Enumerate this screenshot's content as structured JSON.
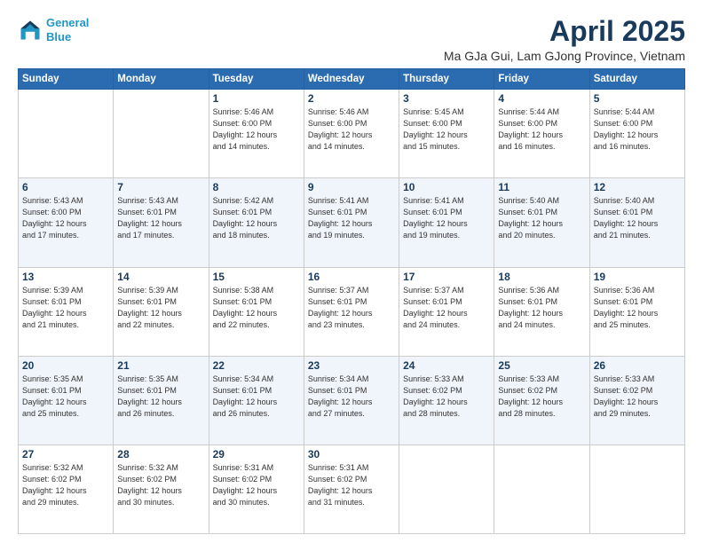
{
  "header": {
    "logo_line1": "General",
    "logo_line2": "Blue",
    "title": "April 2025",
    "subtitle": "Ma GJa Gui, Lam GJong Province, Vietnam"
  },
  "days_of_week": [
    "Sunday",
    "Monday",
    "Tuesday",
    "Wednesday",
    "Thursday",
    "Friday",
    "Saturday"
  ],
  "weeks": [
    [
      {
        "day": "",
        "info": ""
      },
      {
        "day": "",
        "info": ""
      },
      {
        "day": "1",
        "info": "Sunrise: 5:46 AM\nSunset: 6:00 PM\nDaylight: 12 hours\nand 14 minutes."
      },
      {
        "day": "2",
        "info": "Sunrise: 5:46 AM\nSunset: 6:00 PM\nDaylight: 12 hours\nand 14 minutes."
      },
      {
        "day": "3",
        "info": "Sunrise: 5:45 AM\nSunset: 6:00 PM\nDaylight: 12 hours\nand 15 minutes."
      },
      {
        "day": "4",
        "info": "Sunrise: 5:44 AM\nSunset: 6:00 PM\nDaylight: 12 hours\nand 16 minutes."
      },
      {
        "day": "5",
        "info": "Sunrise: 5:44 AM\nSunset: 6:00 PM\nDaylight: 12 hours\nand 16 minutes."
      }
    ],
    [
      {
        "day": "6",
        "info": "Sunrise: 5:43 AM\nSunset: 6:00 PM\nDaylight: 12 hours\nand 17 minutes."
      },
      {
        "day": "7",
        "info": "Sunrise: 5:43 AM\nSunset: 6:01 PM\nDaylight: 12 hours\nand 17 minutes."
      },
      {
        "day": "8",
        "info": "Sunrise: 5:42 AM\nSunset: 6:01 PM\nDaylight: 12 hours\nand 18 minutes."
      },
      {
        "day": "9",
        "info": "Sunrise: 5:41 AM\nSunset: 6:01 PM\nDaylight: 12 hours\nand 19 minutes."
      },
      {
        "day": "10",
        "info": "Sunrise: 5:41 AM\nSunset: 6:01 PM\nDaylight: 12 hours\nand 19 minutes."
      },
      {
        "day": "11",
        "info": "Sunrise: 5:40 AM\nSunset: 6:01 PM\nDaylight: 12 hours\nand 20 minutes."
      },
      {
        "day": "12",
        "info": "Sunrise: 5:40 AM\nSunset: 6:01 PM\nDaylight: 12 hours\nand 21 minutes."
      }
    ],
    [
      {
        "day": "13",
        "info": "Sunrise: 5:39 AM\nSunset: 6:01 PM\nDaylight: 12 hours\nand 21 minutes."
      },
      {
        "day": "14",
        "info": "Sunrise: 5:39 AM\nSunset: 6:01 PM\nDaylight: 12 hours\nand 22 minutes."
      },
      {
        "day": "15",
        "info": "Sunrise: 5:38 AM\nSunset: 6:01 PM\nDaylight: 12 hours\nand 22 minutes."
      },
      {
        "day": "16",
        "info": "Sunrise: 5:37 AM\nSunset: 6:01 PM\nDaylight: 12 hours\nand 23 minutes."
      },
      {
        "day": "17",
        "info": "Sunrise: 5:37 AM\nSunset: 6:01 PM\nDaylight: 12 hours\nand 24 minutes."
      },
      {
        "day": "18",
        "info": "Sunrise: 5:36 AM\nSunset: 6:01 PM\nDaylight: 12 hours\nand 24 minutes."
      },
      {
        "day": "19",
        "info": "Sunrise: 5:36 AM\nSunset: 6:01 PM\nDaylight: 12 hours\nand 25 minutes."
      }
    ],
    [
      {
        "day": "20",
        "info": "Sunrise: 5:35 AM\nSunset: 6:01 PM\nDaylight: 12 hours\nand 25 minutes."
      },
      {
        "day": "21",
        "info": "Sunrise: 5:35 AM\nSunset: 6:01 PM\nDaylight: 12 hours\nand 26 minutes."
      },
      {
        "day": "22",
        "info": "Sunrise: 5:34 AM\nSunset: 6:01 PM\nDaylight: 12 hours\nand 26 minutes."
      },
      {
        "day": "23",
        "info": "Sunrise: 5:34 AM\nSunset: 6:01 PM\nDaylight: 12 hours\nand 27 minutes."
      },
      {
        "day": "24",
        "info": "Sunrise: 5:33 AM\nSunset: 6:02 PM\nDaylight: 12 hours\nand 28 minutes."
      },
      {
        "day": "25",
        "info": "Sunrise: 5:33 AM\nSunset: 6:02 PM\nDaylight: 12 hours\nand 28 minutes."
      },
      {
        "day": "26",
        "info": "Sunrise: 5:33 AM\nSunset: 6:02 PM\nDaylight: 12 hours\nand 29 minutes."
      }
    ],
    [
      {
        "day": "27",
        "info": "Sunrise: 5:32 AM\nSunset: 6:02 PM\nDaylight: 12 hours\nand 29 minutes."
      },
      {
        "day": "28",
        "info": "Sunrise: 5:32 AM\nSunset: 6:02 PM\nDaylight: 12 hours\nand 30 minutes."
      },
      {
        "day": "29",
        "info": "Sunrise: 5:31 AM\nSunset: 6:02 PM\nDaylight: 12 hours\nand 30 minutes."
      },
      {
        "day": "30",
        "info": "Sunrise: 5:31 AM\nSunset: 6:02 PM\nDaylight: 12 hours\nand 31 minutes."
      },
      {
        "day": "",
        "info": ""
      },
      {
        "day": "",
        "info": ""
      },
      {
        "day": "",
        "info": ""
      }
    ]
  ]
}
